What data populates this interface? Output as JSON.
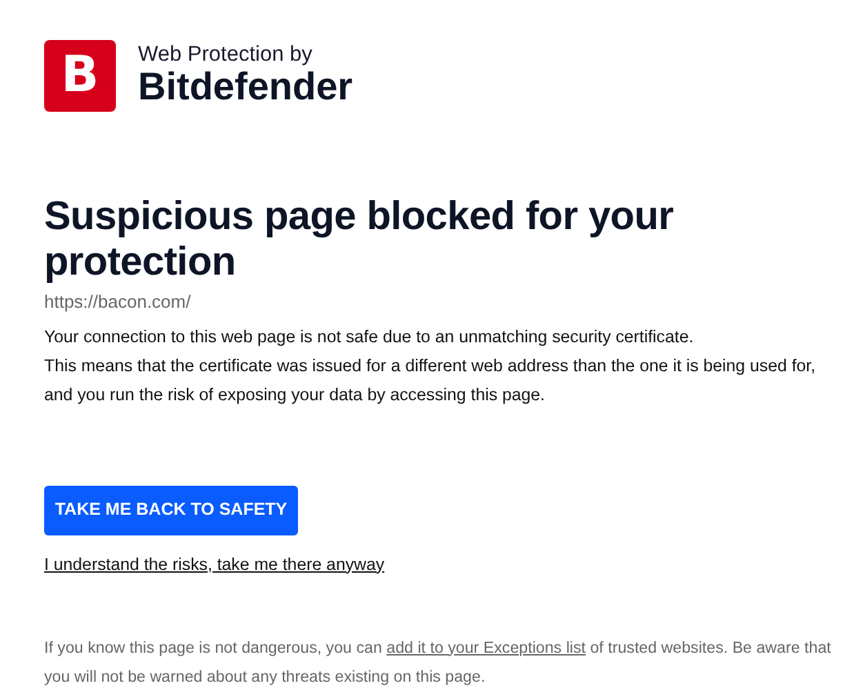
{
  "brand": {
    "logo_letter": "B",
    "tagline": "Web Protection by",
    "name": "Bitdefender"
  },
  "heading": "Suspicious page blocked for your protection",
  "url": "https://bacon.com/",
  "message": [
    "Your connection to this web page is not safe due to an unmatching security certificate.",
    "This means that the certificate was issued for a different web address than the one it is being used for, and you run the risk of exposing your data by accessing this page."
  ],
  "primary_button": "TAKE ME BACK TO SAFETY",
  "proceed_link": "I understand the risks, take me there anyway",
  "footer_note": {
    "before": "If you know this page is not dangerous, you can ",
    "link": "add it to your Exceptions list",
    "after": " of trusted websites. Be aware that you will not be warned about any threats existing on this page."
  }
}
